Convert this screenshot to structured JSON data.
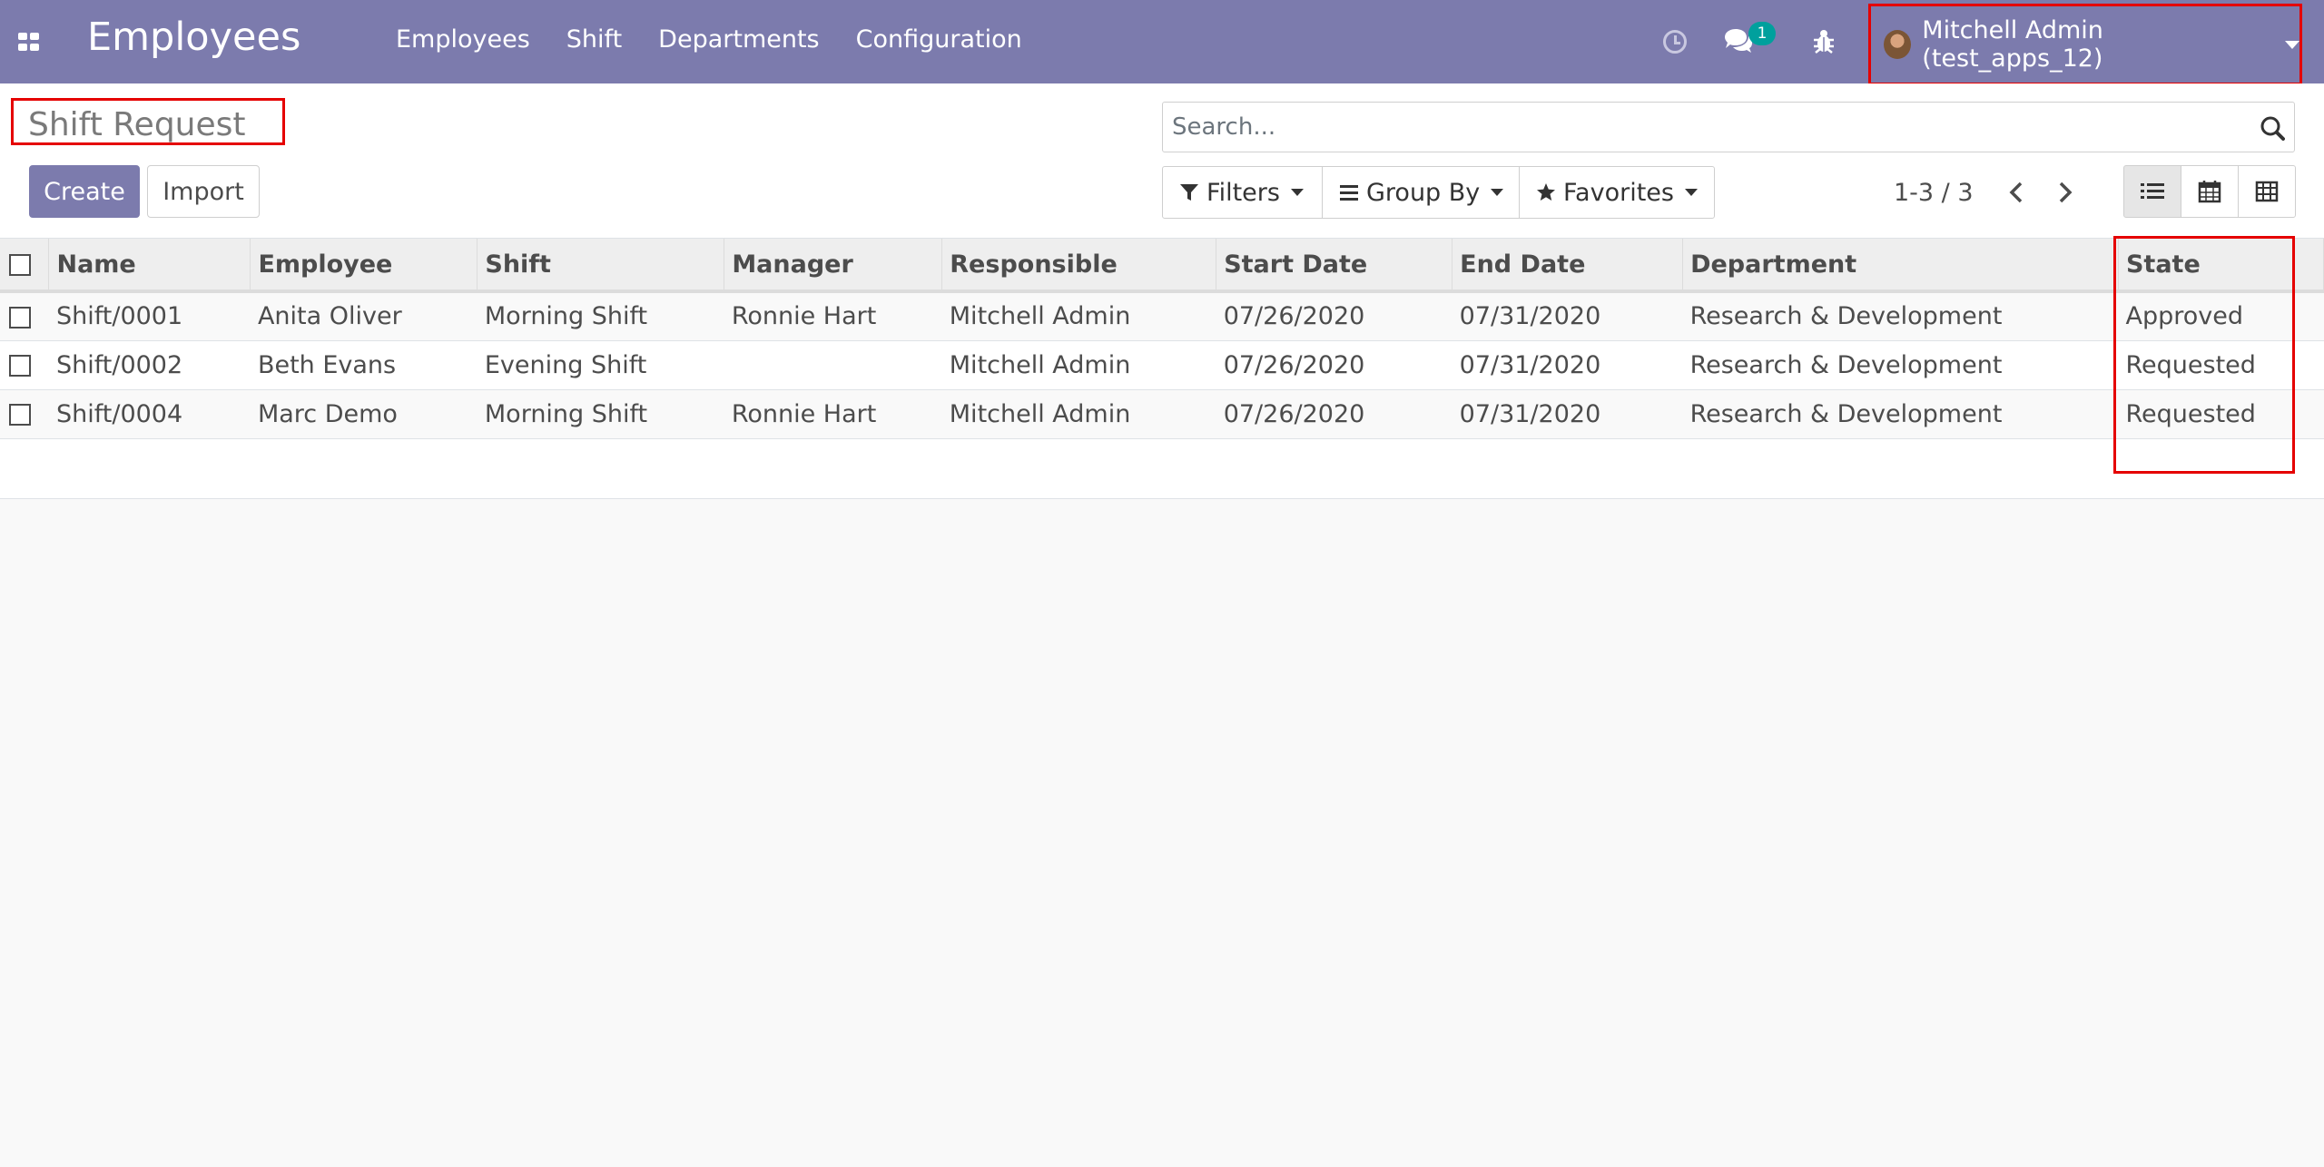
{
  "navbar": {
    "app_title": "Employees",
    "menu": [
      "Employees",
      "Shift",
      "Departments",
      "Configuration"
    ],
    "chat_badge": "1",
    "user_name": "Mitchell Admin (test_apps_12)"
  },
  "control": {
    "breadcrumb": "Shift Request",
    "create_label": "Create",
    "import_label": "Import",
    "search_placeholder": "Search...",
    "filters_label": "Filters",
    "groupby_label": "Group By",
    "favorites_label": "Favorites",
    "pager": "1-3 / 3"
  },
  "table": {
    "columns": [
      "Name",
      "Employee",
      "Shift",
      "Manager",
      "Responsible",
      "Start Date",
      "End Date",
      "Department",
      "State"
    ],
    "rows": [
      [
        "Shift/0001",
        "Anita Oliver",
        "Morning Shift",
        "Ronnie Hart",
        "Mitchell Admin",
        "07/26/2020",
        "07/31/2020",
        "Research & Development",
        "Approved"
      ],
      [
        "Shift/0002",
        "Beth Evans",
        "Evening Shift",
        "",
        "Mitchell Admin",
        "07/26/2020",
        "07/31/2020",
        "Research & Development",
        "Requested"
      ],
      [
        "Shift/0004",
        "Marc Demo",
        "Morning Shift",
        "Ronnie Hart",
        "Mitchell Admin",
        "07/26/2020",
        "07/31/2020",
        "Research & Development",
        "Requested"
      ]
    ]
  },
  "colors": {
    "navbar": "#7c7bad",
    "highlight": "#e50000",
    "badge": "#00a09d"
  }
}
